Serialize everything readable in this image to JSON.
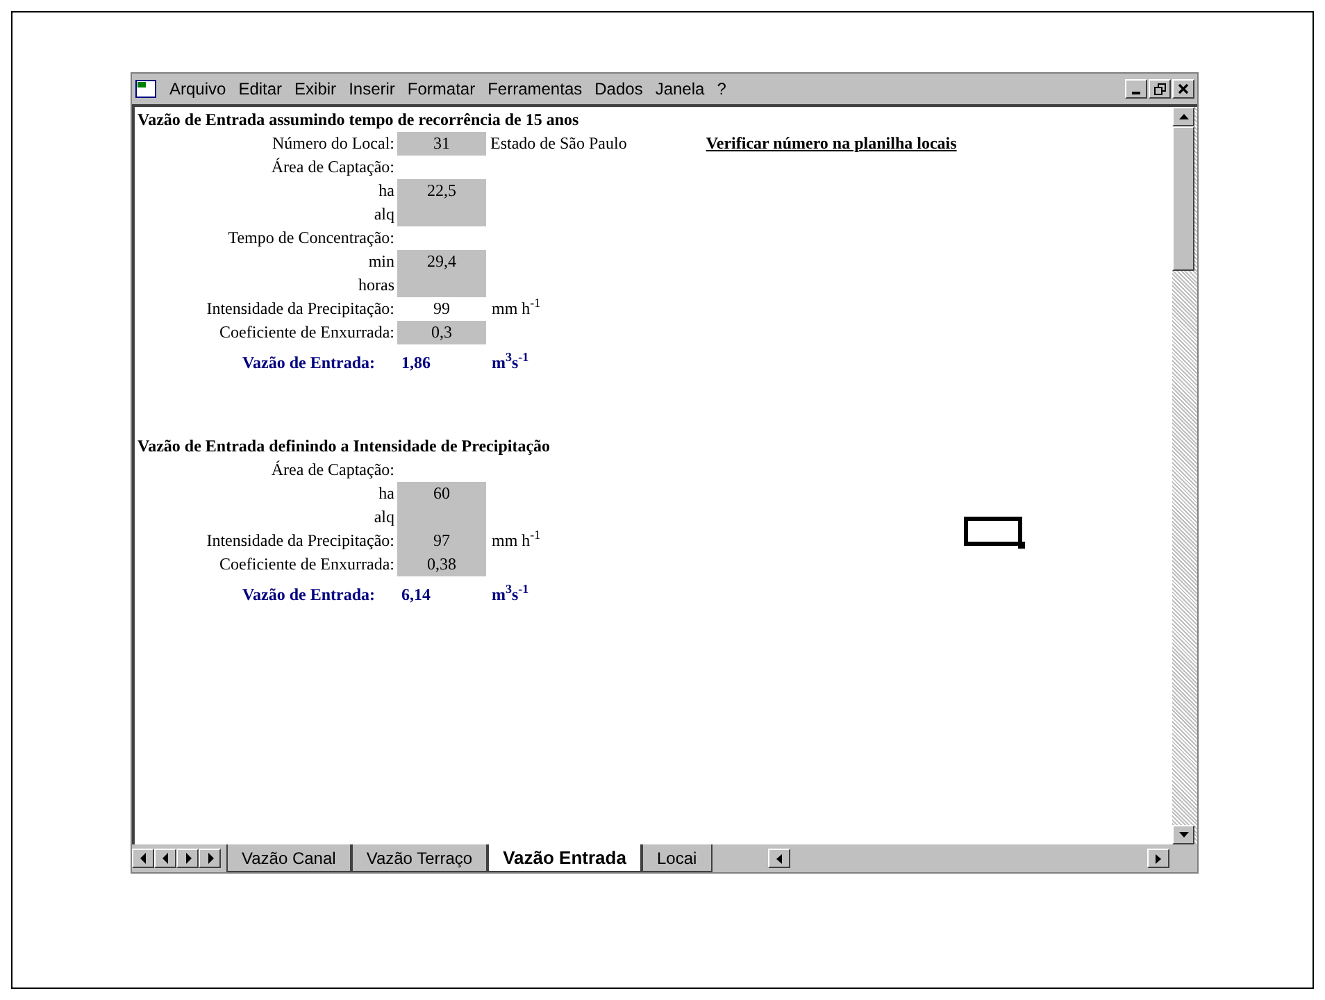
{
  "menu": {
    "items": [
      "Arquivo",
      "Editar",
      "Exibir",
      "Inserir",
      "Formatar",
      "Ferramentas",
      "Dados",
      "Janela",
      "?"
    ]
  },
  "sections": [
    {
      "title": "Vazão de Entrada assumindo tempo de recorrência  de 15 anos",
      "rows": [
        {
          "kind": "field",
          "label": "Número do Local:",
          "value": "31",
          "shaded": true,
          "note": "Estado de São Paulo",
          "link": "Verificar número na planilha locais"
        },
        {
          "kind": "heading",
          "label": "Área de Captação:"
        },
        {
          "kind": "field",
          "label": "ha",
          "value": "22,5",
          "shaded": true
        },
        {
          "kind": "field",
          "label": "alq",
          "shaded": true
        },
        {
          "kind": "heading",
          "label": "Tempo de Concentração:"
        },
        {
          "kind": "field",
          "label": "min",
          "value": "29,4",
          "shaded": true
        },
        {
          "kind": "field",
          "label": "horas",
          "shaded": true
        },
        {
          "kind": "field",
          "label": "Intensidade da Precipitação:",
          "value": "99",
          "shaded": false,
          "unit": "mm h$^{-1}$"
        },
        {
          "kind": "field",
          "label": "Coeficiente de Enxurrada:",
          "value": "0,3",
          "shaded": true
        },
        {
          "kind": "result",
          "label": "Vazão de Entrada:",
          "value": "1,86",
          "unit": "m$^{3}$s$^{-1}$"
        }
      ]
    },
    {
      "title": "Vazão de Entrada definindo a Intensidade de Precipitação",
      "rows": [
        {
          "kind": "heading",
          "label": "Área de Captação:"
        },
        {
          "kind": "field",
          "label": "ha",
          "value": "60",
          "shaded": true
        },
        {
          "kind": "field",
          "label": "alq",
          "shaded": true
        },
        {
          "kind": "field",
          "label": "Intensidade da Precipitação:",
          "value": "97",
          "shaded": true,
          "unit": "mm h$^{-1}$"
        },
        {
          "kind": "field",
          "label": "Coeficiente de Enxurrada:",
          "value": "0,38",
          "shaded": true
        },
        {
          "kind": "result",
          "label": "Vazão de Entrada:",
          "value": "6,14",
          "unit": "m$^{3}$s$^{-1}$"
        }
      ]
    }
  ],
  "sheet_tabs": [
    {
      "label": "Vazão Canal",
      "selected": false
    },
    {
      "label": "Vazão Terraço",
      "selected": false
    },
    {
      "label": "Vazão Entrada",
      "selected": true
    },
    {
      "label": "Locai",
      "selected": false
    }
  ]
}
